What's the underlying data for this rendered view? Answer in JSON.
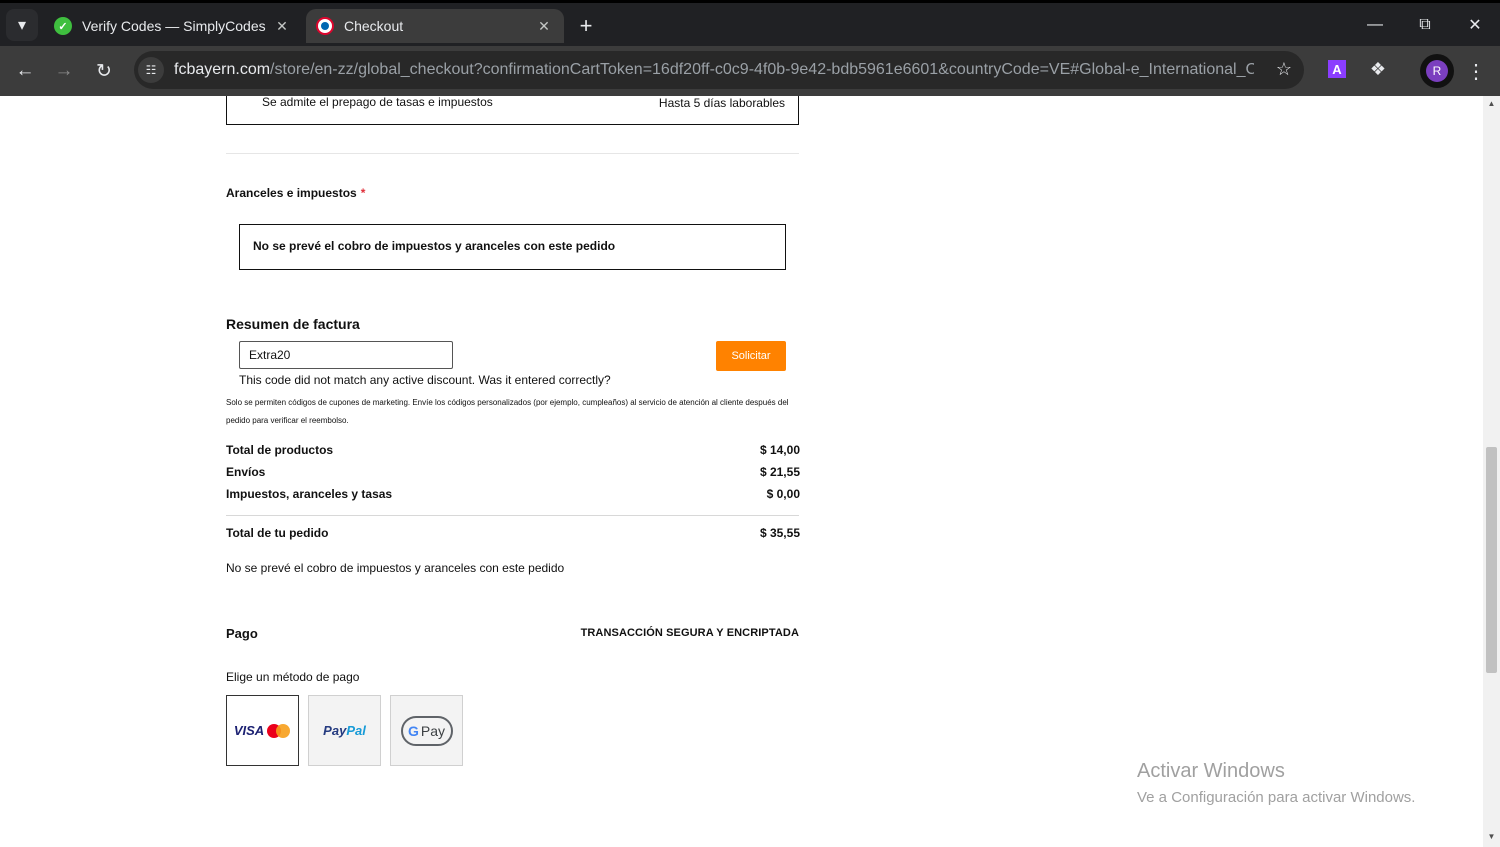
{
  "browser": {
    "tabs": [
      {
        "title": "Verify Codes — SimplyCodes",
        "icon": "simplycodes-icon"
      },
      {
        "title": "Checkout",
        "icon": "fc-bayern-icon"
      }
    ],
    "url_host": "fcbayern.com",
    "url_rest": "/store/en-zz/global_checkout?confirmationCartToken=16df20ff-c0c9-4f0b-9e42-bdb5961e6601&countryCode=VE#Global-e_International_Chec...",
    "profile_initial": "R",
    "extension_label": "A"
  },
  "shipping": {
    "prepay_text": "Se admite el prepago de tasas e impuestos",
    "delivery_time": "Hasta 5 días laborables"
  },
  "duties": {
    "title": "Aranceles e impuestos",
    "required_mark": "*",
    "option_text": "No se prevé el cobro de impuestos y aranceles con este pedido"
  },
  "summary": {
    "title": "Resumen de factura",
    "coupon_value": "Extra20",
    "apply_label": "Solicitar",
    "coupon_error": "This code did not match any active discount. Was it entered correctly?",
    "coupon_note": "Solo se permiten códigos de cupones de marketing. Envíe los códigos personalizados (por ejemplo, cumpleaños) al servicio de atención al cliente después del pedido para verificar el reembolso.",
    "rows": [
      {
        "label": "Total de productos",
        "value": "$ 14,00"
      },
      {
        "label": "Envíos",
        "value": "$ 21,55"
      },
      {
        "label": "Impuestos, aranceles y tasas",
        "value": "$ 0,00"
      }
    ],
    "total_label": "Total de tu pedido",
    "total_value": "$ 35,55",
    "duties_note": "No se prevé el cobro de impuestos y aranceles con este pedido"
  },
  "payment": {
    "title": "Pago",
    "secure_label": "TRANSACCIÓN SEGURA Y ENCRIPTADA",
    "choose_label": "Elige un método de pago",
    "methods": [
      {
        "name": "card",
        "label": "VISA",
        "selected": true
      },
      {
        "name": "paypal",
        "label_a": "Pay",
        "label_b": "Pal",
        "selected": false
      },
      {
        "name": "googlepay",
        "label_g": "G",
        "label_pay": "Pay",
        "selected": false
      }
    ]
  },
  "windows_watermark": {
    "line1": "Activar Windows",
    "line2": "Ve a Configuración para activar Windows."
  },
  "colors": {
    "accent_button": "#ff8200",
    "required": "#e0303a"
  }
}
